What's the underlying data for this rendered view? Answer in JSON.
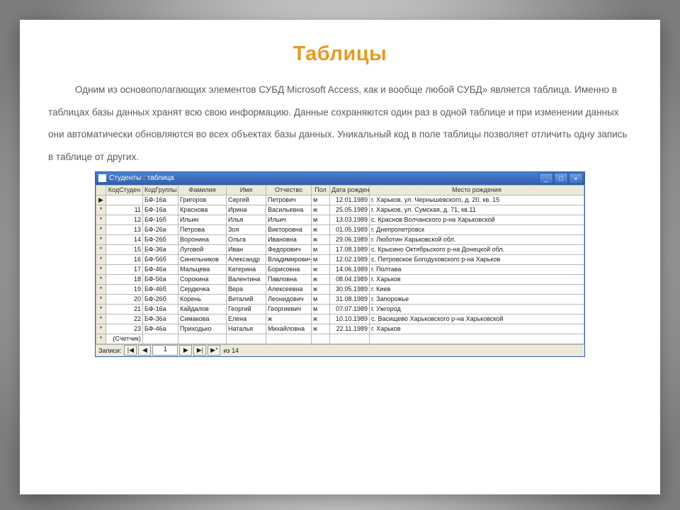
{
  "title": "Таблицы",
  "paragraph": "Одним из основополагающих элементов СУБД Microsoft Access, как и вообще любой СУБД» является таблица. Именно в таблицах базы данных хранят всю свою информацию. Данные сохраняются один раз в одной таблице и при изменении данных они автоматически обновляются во всех объектах базы данных. Уникальный код в поле таблицы позволяет отличить одну запись в таблице от других.",
  "window": {
    "caption": "Студенты : таблица",
    "columns": [
      "",
      "КодСтуден",
      "КодГруппы",
      "Фамилия",
      "Имя",
      "Отчество",
      "Пол",
      "Дата рожден",
      "Место рождения"
    ],
    "rows": [
      [
        "▶",
        "",
        "БФ-16а",
        "Григоров",
        "Сергей",
        "Петрович",
        "м",
        "12.01.1989",
        "г. Харьков, ул. Чернышевского, д. 20, кв. 15"
      ],
      [
        "*",
        "11",
        "БФ-16а",
        "Краснова",
        "Ирина",
        "Васильевна",
        "ж",
        "25.05.1989",
        "г. Харьков, ул. Сумская, д. 71, кв.11"
      ],
      [
        "*",
        "12",
        "БФ-16б",
        "Ильин",
        "Илья",
        "Ильич",
        "м",
        "13.03.1989",
        "с. Краснов  Волчанского р-на  Харьковской"
      ],
      [
        "*",
        "13",
        "БФ-26а",
        "Петрова",
        "Зоя",
        "Викторовна",
        "ж",
        "01.05.1989",
        "г. Днепропетровск"
      ],
      [
        "*",
        "14",
        "БФ-26б",
        "Воронина",
        "Ольга",
        "Ивановна",
        "ж",
        "29.06.1989",
        "г. Люботин Харьковской обл."
      ],
      [
        "*",
        "15",
        "БФ-36а",
        "Луговой",
        "Иван",
        "Федорович",
        "м",
        "17.08.1989",
        "с. Крысино Октябрьского р-на Донецкой обл."
      ],
      [
        "*",
        "16",
        "БФ-56б",
        "Синельников",
        "Александр",
        "Владимирович",
        "м",
        "12.02.1989",
        "с. Петровское Богодуховского р-на Харьков"
      ],
      [
        "*",
        "17",
        "БФ-46а",
        "Мальцева",
        "Катерина",
        "Борисовна",
        "ж",
        "14.06.1989",
        "г. Полтава"
      ],
      [
        "*",
        "18",
        "БФ-56а",
        "Сорокина",
        "Валентина",
        "Павловна",
        "ж",
        "08.04.1989",
        "г. Харьков"
      ],
      [
        "*",
        "19",
        "БФ-46б",
        "Сердючка",
        "Вера",
        "Алексеевна",
        "ж",
        "30.05.1989",
        "г. Киев"
      ],
      [
        "*",
        "20",
        "БФ-26б",
        "Корень",
        "Виталий",
        "Леонидович",
        "м",
        "31.08.1989",
        "г. Запорожье"
      ],
      [
        "*",
        "21",
        "БФ-16а",
        "Кайдалов",
        "Георгий",
        "Георгиевич",
        "м",
        "07.07.1989",
        "г. Ужгород"
      ],
      [
        "*",
        "22",
        "БФ-36а",
        "Симакова",
        "Елена",
        "ж",
        "ж",
        "10.10.1989",
        "с. Васищево Харьковского р-на Харьковской"
      ],
      [
        "*",
        "23",
        "БФ-46а",
        "Приходько",
        "Наталья",
        "Михайловна",
        "ж",
        "22.11.1989",
        "г. Харьков"
      ],
      [
        "*",
        "(Счетчик)",
        "",
        "",
        "",
        "",
        "",
        "",
        ""
      ]
    ],
    "nav_label": "Записи:",
    "nav_first": "|◀",
    "nav_prev": "◀",
    "nav_value": "1",
    "nav_next": "▶",
    "nav_last": "▶|",
    "nav_new": "▶*",
    "nav_of": "из  14"
  }
}
